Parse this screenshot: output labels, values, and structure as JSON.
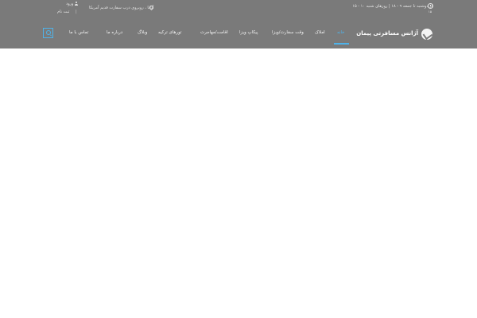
{
  "topbar": {
    "hours": "از دوشنبه تا جمعه ۹ - ۱۸ | روزهای شنبه ۱۰ - ۱۵",
    "hours_suffix": "۱۵",
    "address": "آدانا ، روبروی درب سفارت قدیم آمریکا",
    "login": "ورود",
    "separator": "|",
    "register": "ثبت نام"
  },
  "logo": {
    "text": "آژانس مسافرتی پیمان"
  },
  "nav": {
    "items": [
      {
        "label": "خانه"
      },
      {
        "label": "املاک"
      },
      {
        "label": "وقت سفارت/ویزا"
      },
      {
        "label": "پیکاپ ویزا"
      },
      {
        "label": "اقامت/مهاجرت"
      },
      {
        "label": "تورهای ترکیه"
      },
      {
        "label": "وبلاگ"
      },
      {
        "label": "درباره ما"
      },
      {
        "label": "تماس با ما"
      }
    ]
  },
  "colors": {
    "header_bg": "#7a7a7a",
    "accent": "#4fb3ea",
    "page_bg": "#ffffff"
  }
}
